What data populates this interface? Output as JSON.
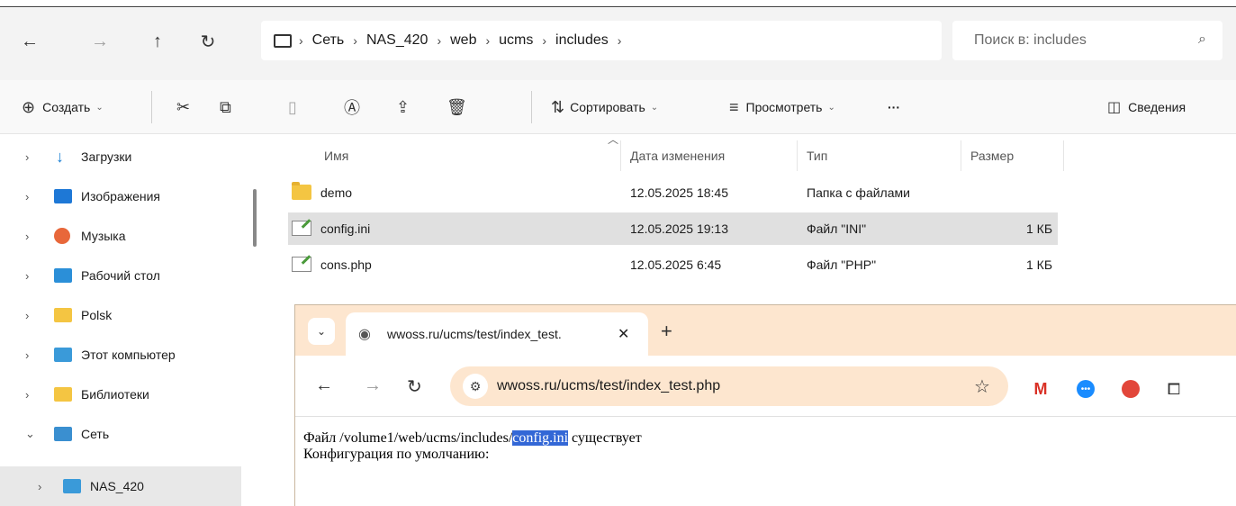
{
  "explorer": {
    "breadcrumb": [
      "Сеть",
      "NAS_420",
      "web",
      "ucms",
      "includes"
    ],
    "search_placeholder": "Поиск в: includes",
    "toolbar": {
      "create": "Создать",
      "sort": "Сортировать",
      "view": "Просмотреть",
      "more": "···",
      "details": "Сведения"
    },
    "sidebar": [
      {
        "label": "Загрузки",
        "expanded": false
      },
      {
        "label": "Изображения",
        "expanded": false
      },
      {
        "label": "Музыка",
        "expanded": false
      },
      {
        "label": "Рабочий стол",
        "expanded": false
      },
      {
        "label": "Polsk",
        "expanded": false
      },
      {
        "label": "Этот компьютер",
        "expanded": false
      },
      {
        "label": "Библиотеки",
        "expanded": false
      },
      {
        "label": "Сеть",
        "expanded": true
      },
      {
        "label": "NAS_420",
        "expanded": false,
        "selected": true
      }
    ],
    "columns": {
      "name": "Имя",
      "date": "Дата изменения",
      "type": "Тип",
      "size": "Размер"
    },
    "files": [
      {
        "name": "demo",
        "date": "12.05.2025 18:45",
        "type": "Папка с файлами",
        "size": "",
        "kind": "folder"
      },
      {
        "name": "config.ini",
        "date": "12.05.2025 19:13",
        "type": "Файл \"INI\"",
        "size": "1 КБ",
        "kind": "file",
        "selected": true
      },
      {
        "name": "cons.php",
        "date": "12.05.2025 6:45",
        "type": "Файл \"PHP\"",
        "size": "1 КБ",
        "kind": "file"
      }
    ]
  },
  "browser": {
    "tab_title": "wwoss.ru/ucms/test/index_test.",
    "url": "wwoss.ru/ucms/test/index_test.php",
    "content": {
      "line1_prefix": "Файл /volume1/web/ucms/includes/",
      "line1_selected": "config.ini",
      "line1_suffix": " существует",
      "line2": "Конфигурация по умолчанию:"
    }
  },
  "colors": {
    "accent_selection": "#3367d6",
    "browser_frame": "#fde6cf",
    "folder": "#f4c542"
  }
}
